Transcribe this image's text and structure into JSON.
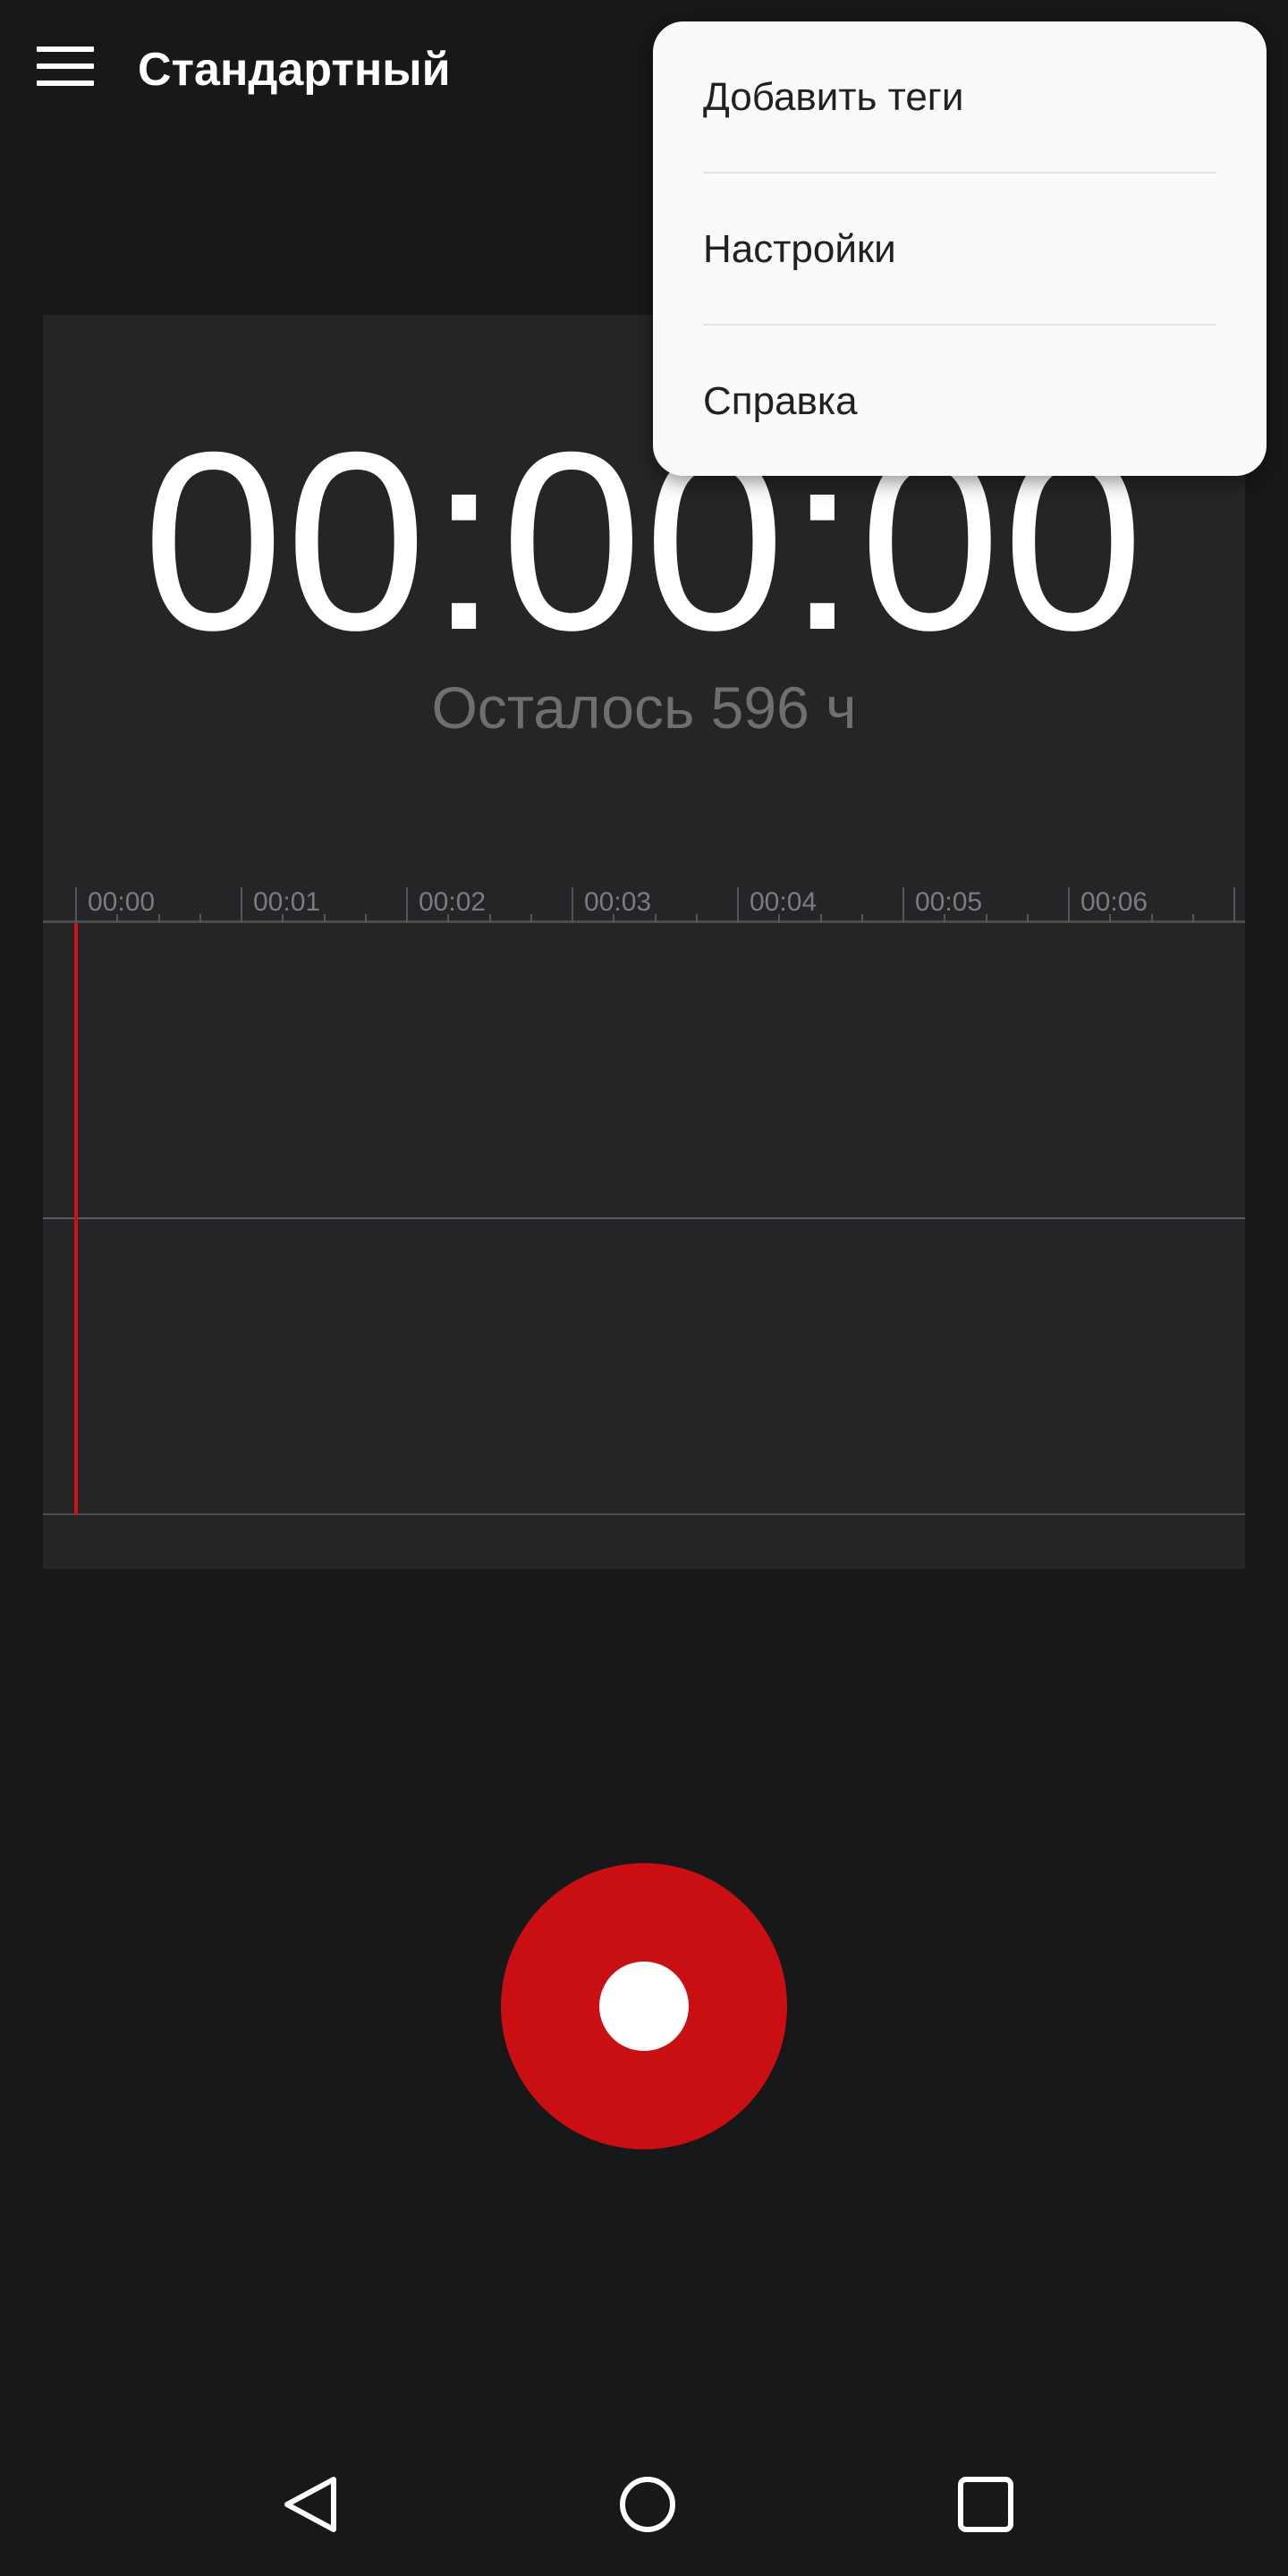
{
  "header": {
    "title": "Стандартный",
    "menu_icon": "hamburger-menu-icon"
  },
  "recorder": {
    "timer": "00:00:00",
    "remaining": "Осталось 596 ч",
    "timeline_labels": [
      "00:00",
      "00:01",
      "00:02",
      "00:03",
      "00:04",
      "00:05",
      "00:06"
    ]
  },
  "record_button": {
    "icon": "record-icon"
  },
  "overflow_menu": {
    "items": [
      {
        "label": "Добавить теги"
      },
      {
        "label": "Настройки"
      },
      {
        "label": "Справка"
      }
    ]
  },
  "nav_bar": {
    "back_icon": "back-triangle-icon",
    "home_icon": "home-circle-icon",
    "recents_icon": "recents-square-icon"
  },
  "colors": {
    "background": "#17181a",
    "panel": "#242527",
    "accent_red": "#c90f12",
    "playhead": "#d50f14",
    "menu_background": "#fafafa"
  }
}
